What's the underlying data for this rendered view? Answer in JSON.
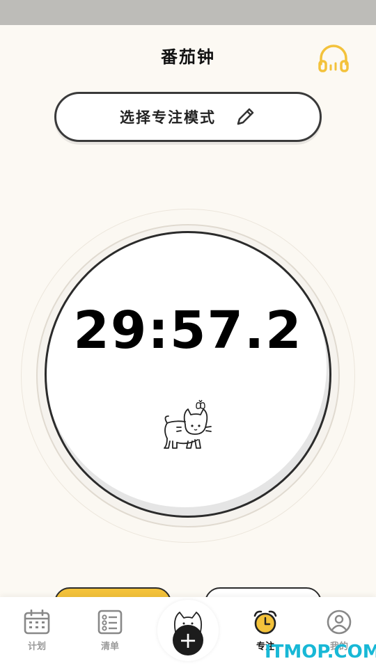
{
  "header": {
    "title": "番茄钟",
    "headphones_icon": "headphones-icon"
  },
  "mode_selector": {
    "label": "选择专注模式",
    "icon": "pencil-icon"
  },
  "timer": {
    "display": "29:57.2"
  },
  "tabbar": {
    "tabs": [
      {
        "label": "计划",
        "icon": "calendar-icon",
        "active": false
      },
      {
        "label": "清单",
        "icon": "checklist-icon",
        "active": false
      },
      {
        "label": "专注",
        "icon": "alarm-clock-icon",
        "active": true
      },
      {
        "label": "我的",
        "icon": "user-icon",
        "active": false
      }
    ],
    "fab_symbol": "+"
  },
  "colors": {
    "accent": "#f3c23b",
    "background": "#fcf9f3",
    "ink": "#2b2b2b"
  },
  "watermark": "ITMOP.COM"
}
